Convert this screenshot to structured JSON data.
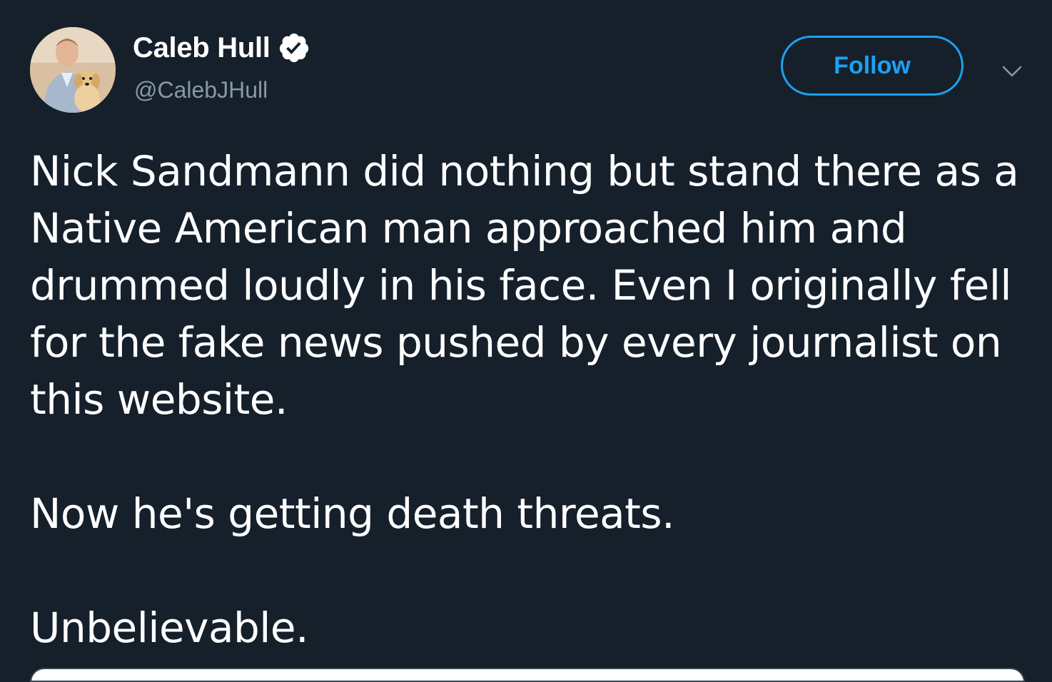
{
  "author": {
    "display_name": "Caleb Hull",
    "handle": "@CalebJHull",
    "avatar_icon": "avatar-photo-with-dog",
    "verified_icon": "verified-badge-icon"
  },
  "actions": {
    "follow_label": "Follow",
    "more_icon": "chevron-down-icon"
  },
  "tweet": {
    "paragraphs": [
      "Nick Sandmann did nothing but stand there as a Native American man approached him and drummed loudly in his face. Even I originally fell for the fake news pushed by every journalist on this website.",
      "Now he's getting death threats.",
      "Unbelievable."
    ]
  },
  "colors": {
    "background": "#15202b",
    "accent": "#1da1f2",
    "secondary_text": "#8899a6",
    "text": "#ffffff"
  }
}
